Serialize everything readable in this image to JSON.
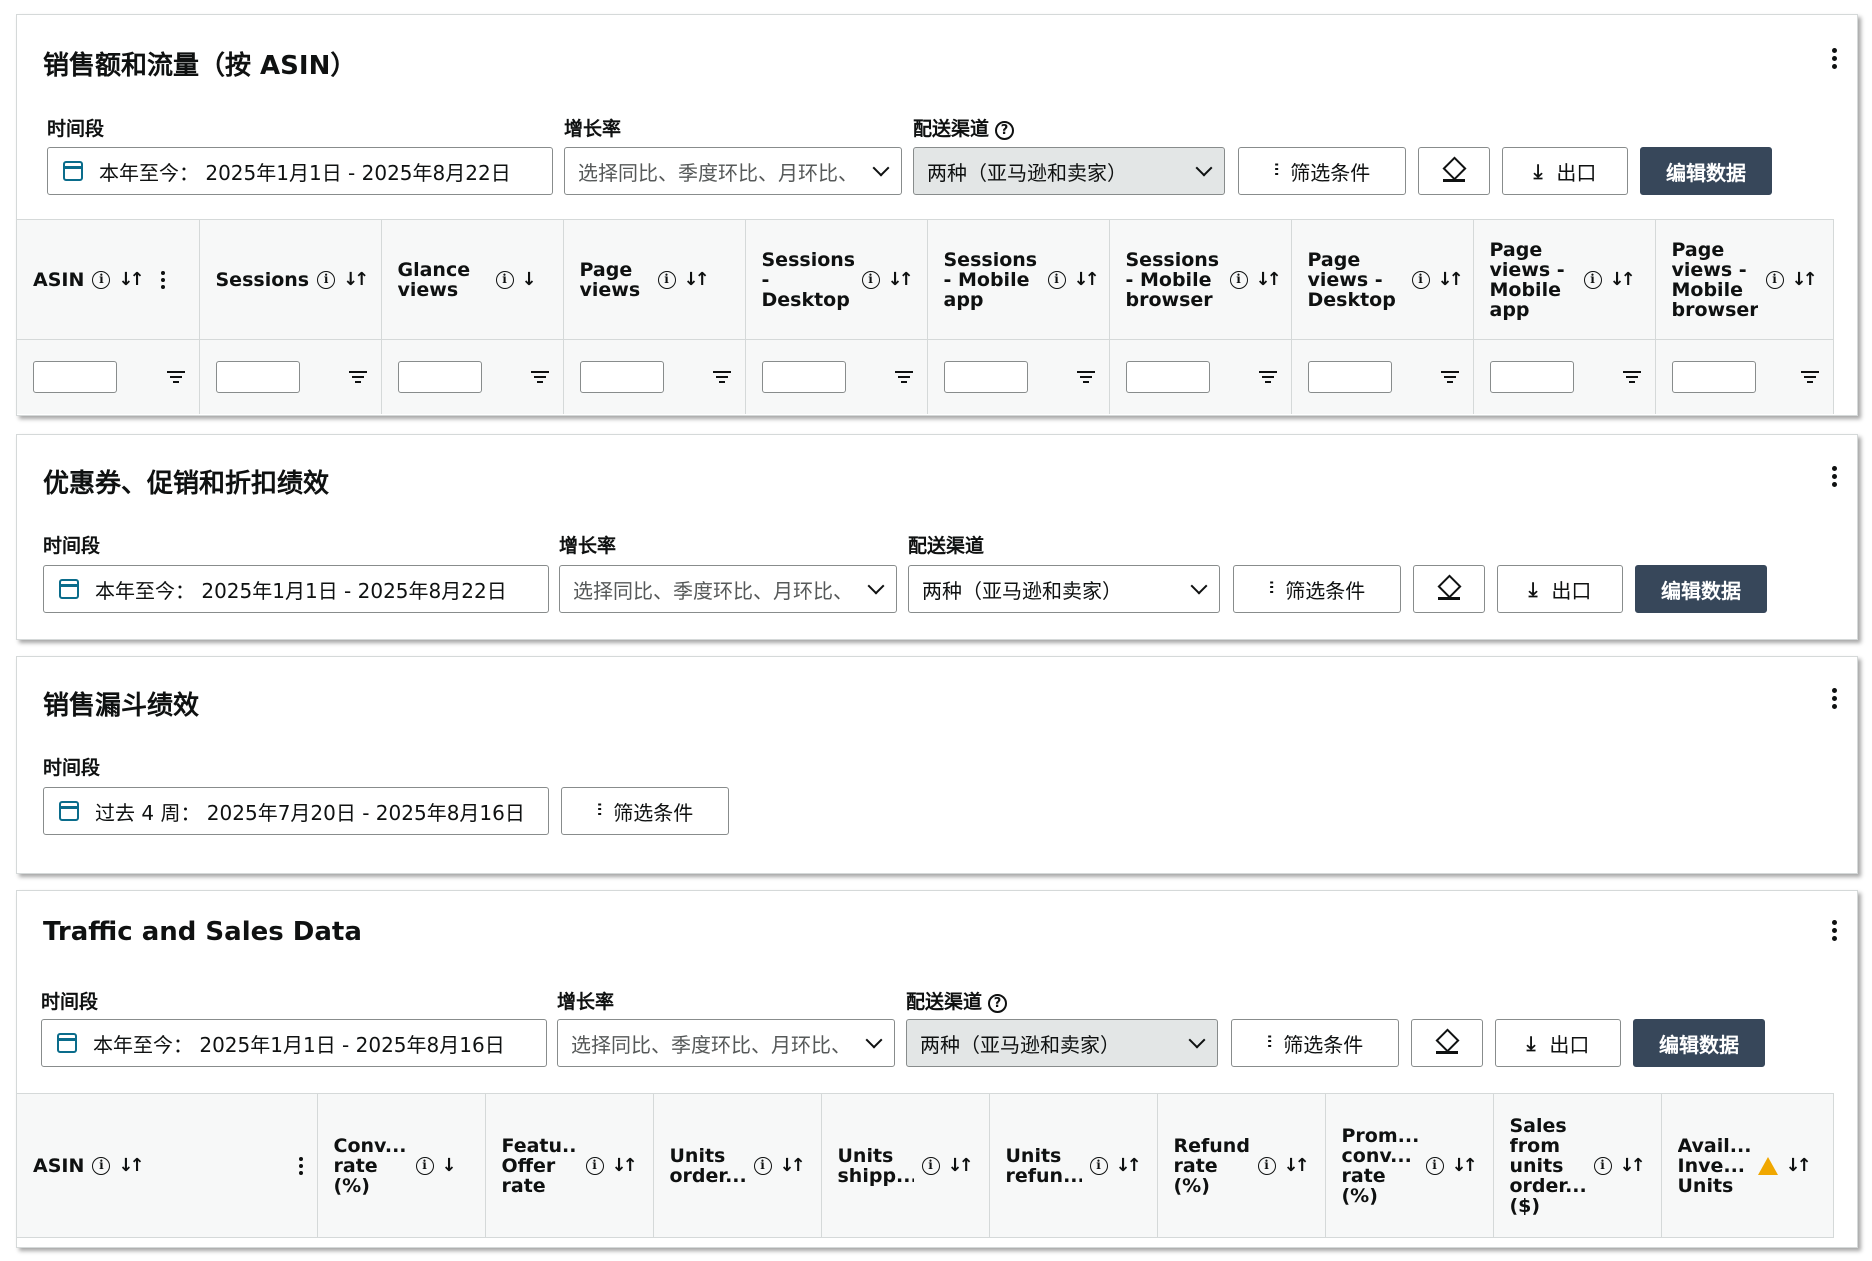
{
  "card1": {
    "title": "销售额和流量（按 ASIN）",
    "period_label": "时间段",
    "period_value": "本年至今：  2025年1月1日 - 2025年8月22日",
    "growth_label": "增长率",
    "growth_placeholder": "选择同比、季度环比、月环比、",
    "channel_label": "配送渠道",
    "channel_value": "两种（亚马逊和卖家）",
    "filter_button": "筛选条件",
    "export_button": "出口",
    "edit_button": "编辑数据",
    "columns": [
      "ASIN",
      "Sessions",
      "Glance views",
      "Page views",
      "Sessions - Desktop",
      "Sessions - Mobile app",
      "Sessions - Mobile browser",
      "Page views - Desktop",
      "Page views - Mobile app",
      "Page views - Mobile browser"
    ]
  },
  "card2": {
    "title": "优惠券、促销和折扣绩效",
    "period_label": "时间段",
    "period_value": "本年至今：  2025年1月1日 - 2025年8月22日",
    "growth_label": "增长率",
    "growth_placeholder": "选择同比、季度环比、月环比、",
    "channel_label": "配送渠道",
    "channel_value": "两种（亚马逊和卖家）",
    "filter_button": "筛选条件",
    "export_button": "出口",
    "edit_button": "编辑数据"
  },
  "card3": {
    "title": "销售漏斗绩效",
    "period_label": "时间段",
    "period_value": "过去 4 周：  2025年7月20日 - 2025年8月16日",
    "filter_button": "筛选条件"
  },
  "card4": {
    "title": "Traffic and Sales Data",
    "period_label": "时间段",
    "period_value": "本年至今：  2025年1月1日 - 2025年8月16日",
    "growth_label": "增长率",
    "growth_placeholder": "选择同比、季度环比、月环比、",
    "channel_label": "配送渠道",
    "channel_value": "两种（亚马逊和卖家）",
    "filter_button": "筛选条件",
    "export_button": "出口",
    "edit_button": "编辑数据",
    "columns": [
      "ASIN",
      "Conv... rate (%)",
      "Featu... Offer rate",
      "Units order...",
      "Units shipp...",
      "Units refun...",
      "Refund rate (%)",
      "Prom... conv... rate (%)",
      "Sales from units order... ($)",
      "Avail... Inve... Units"
    ]
  },
  "icons": {
    "calendar": "calendar-icon",
    "help": "help-icon",
    "info": "info-icon",
    "sort": "sort-icon",
    "sort_desc": "sort-desc-icon",
    "filter": "filter-sliders-icon",
    "paint": "paint-bucket-icon",
    "download": "download-icon",
    "funnel": "funnel-icon",
    "kebab": "more-vertical-icon",
    "warning": "warning-icon"
  },
  "colors": {
    "primary_button": "#37475a",
    "calendar_icon": "#0a6c8b",
    "warning": "#f0a700",
    "disabled_select": "#e3e6e6"
  }
}
